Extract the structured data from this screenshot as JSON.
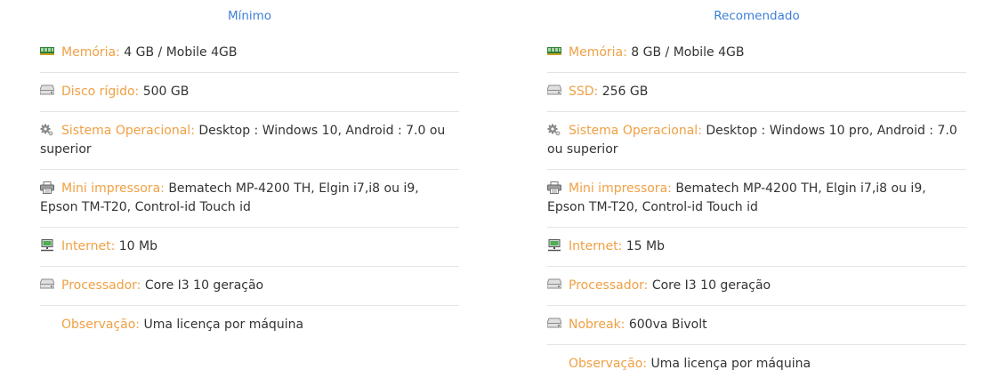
{
  "colors": {
    "title": "#3d7fd6",
    "label": "#f0a044",
    "text": "#333333",
    "divider": "#e4e4e4"
  },
  "minimum": {
    "title": "Mínimo",
    "items": [
      {
        "icon": "memory-icon",
        "label": "Memória:",
        "value": "4 GB / Mobile 4GB"
      },
      {
        "icon": "hard-drive-icon",
        "label": "Disco rígido:",
        "value": "500 GB"
      },
      {
        "icon": "gear-icon",
        "label": "Sistema Operacional:",
        "value": "Desktop : Windows 10, Android : 7.0 ou superior"
      },
      {
        "icon": "printer-icon",
        "label": "Mini impressora:",
        "value": "Bematech MP-4200 TH, Elgin i7,i8 ou i9, Epson TM-T20, Control-id Touch id"
      },
      {
        "icon": "network-icon",
        "label": "Internet:",
        "value": "10 Mb"
      },
      {
        "icon": "processor-icon",
        "label": "Processador:",
        "value": "Core I3 10 geração"
      },
      {
        "icon": "",
        "label": "Observação:",
        "value": "Uma licença por máquina"
      }
    ]
  },
  "recommended": {
    "title": "Recomendado",
    "items": [
      {
        "icon": "memory-icon",
        "label": "Memória:",
        "value": "8 GB / Mobile 4GB"
      },
      {
        "icon": "hard-drive-icon",
        "label": "SSD:",
        "value": "256 GB"
      },
      {
        "icon": "gear-icon",
        "label": "Sistema Operacional:",
        "value": "Desktop : Windows 10 pro, Android : 7.0 ou superior"
      },
      {
        "icon": "printer-icon",
        "label": "Mini impressora:",
        "value": "Bematech MP-4200 TH, Elgin i7,i8 ou i9, Epson TM-T20, Control-id Touch id"
      },
      {
        "icon": "network-icon",
        "label": "Internet:",
        "value": "15 Mb"
      },
      {
        "icon": "processor-icon",
        "label": "Processador:",
        "value": "Core I3 10 geração"
      },
      {
        "icon": "ups-icon",
        "label": "Nobreak:",
        "value": "600va Bivolt"
      },
      {
        "icon": "",
        "label": "Observação:",
        "value": "Uma licença por máquina"
      }
    ]
  }
}
